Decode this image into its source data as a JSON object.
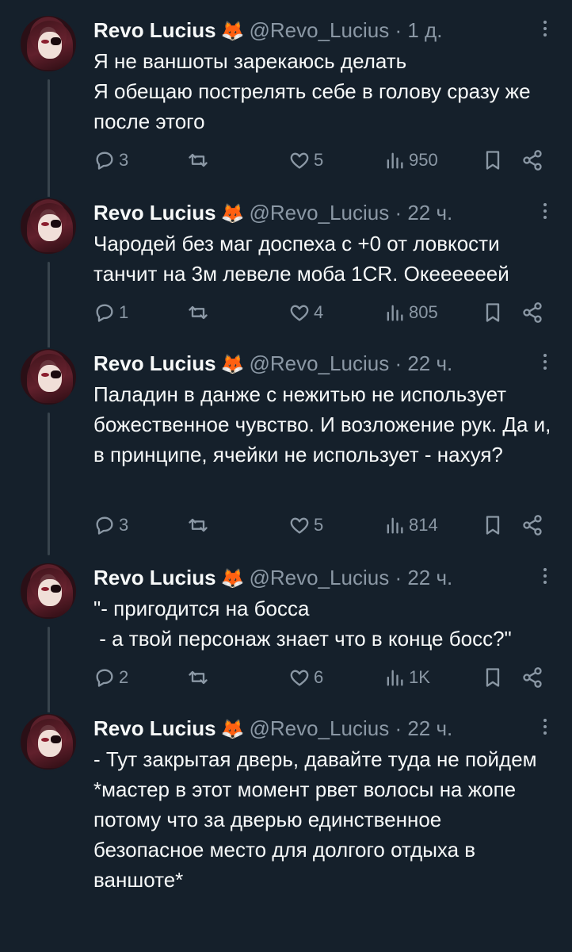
{
  "tweets": [
    {
      "name": "Revo Lucius",
      "badge": "🦊",
      "handle": "@Revo_Lucius",
      "sep": "·",
      "time": "1 д.",
      "text": "Я не ваншоты зарекаюсь делать\nЯ обещаю пострелять себе в голову сразу же после этого",
      "replies": "3",
      "retweets": "",
      "likes": "5",
      "views": "950"
    },
    {
      "name": "Revo Lucius",
      "badge": "🦊",
      "handle": "@Revo_Lucius",
      "sep": "·",
      "time": "22 ч.",
      "text": "Чародей без маг доспеха с +0 от ловкости танчит на 3м левеле моба 1CR. Океееееей",
      "replies": "1",
      "retweets": "",
      "likes": "4",
      "views": "805"
    },
    {
      "name": "Revo Lucius",
      "badge": "🦊",
      "handle": "@Revo_Lucius",
      "sep": "·",
      "time": "22 ч.",
      "text": "Паладин в данже с нежитью не использует божественное чувство. И возложение рук. Да и, в принципе, ячейки не использует - нахуя?",
      "replies": "3",
      "retweets": "",
      "likes": "5",
      "views": "814"
    },
    {
      "name": "Revo Lucius",
      "badge": "🦊",
      "handle": "@Revo_Lucius",
      "sep": "·",
      "time": "22 ч.",
      "text": "\"- пригодится на босса\n - а твой персонаж знает что в конце босс?\"",
      "replies": "2",
      "retweets": "",
      "likes": "6",
      "views": "1K"
    },
    {
      "name": "Revo Lucius",
      "badge": "🦊",
      "handle": "@Revo_Lucius",
      "sep": "·",
      "time": "22 ч.",
      "text": "- Тут закрытая дверь, давайте туда не пойдем\n*мастер в этот момент рвет волосы на жопе потому что за дверью единственное безопасное место для долгого отдыха в ваншоте*",
      "replies": "",
      "retweets": "",
      "likes": "",
      "views": ""
    }
  ],
  "colors": {
    "background": "#15202b",
    "text": "#f7f9f9",
    "muted": "#8b98a5",
    "thread": "#38444d"
  },
  "icons": [
    "reply-icon",
    "retweet-icon",
    "like-icon",
    "views-icon",
    "bookmark-icon",
    "share-icon",
    "more-icon",
    "fox-badge-icon"
  ]
}
